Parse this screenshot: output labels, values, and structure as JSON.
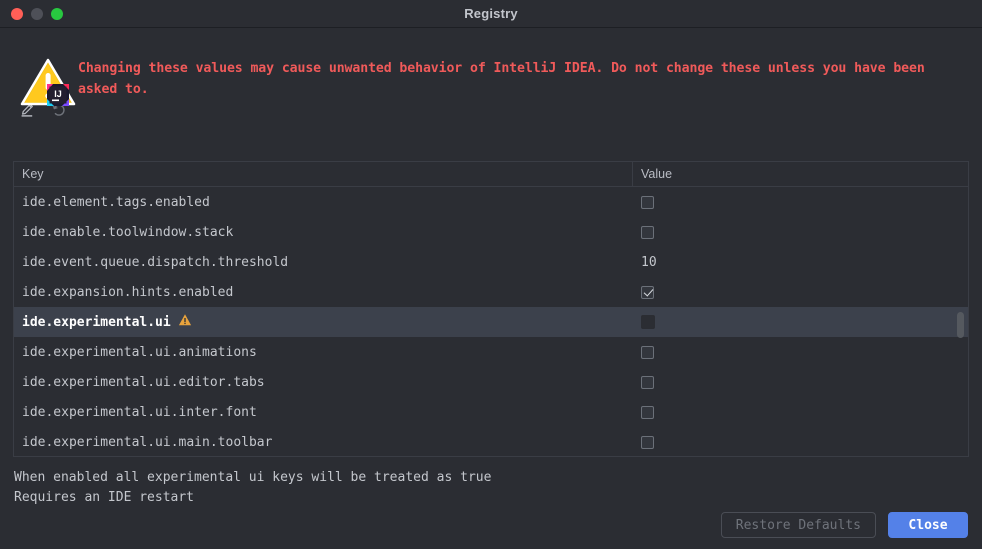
{
  "window": {
    "title": "Registry",
    "traffic_lights": [
      "close-button",
      "minimize-button",
      "maximize-button"
    ]
  },
  "banner": {
    "icon": "warning-triangle-intellij-icon",
    "text": "Changing these values may cause unwanted behavior of IntelliJ IDEA. Do not change these unless you have been asked to."
  },
  "toolbar": {
    "items": [
      {
        "name": "edit-icon",
        "tooltip": "Edit"
      },
      {
        "name": "revert-icon",
        "tooltip": "Revert"
      }
    ]
  },
  "table": {
    "columns": {
      "key": "Key",
      "value": "Value"
    },
    "rows": [
      {
        "key": "ide.element.tags.enabled",
        "value_type": "checkbox",
        "value": "unchecked",
        "selected": false,
        "warning": false
      },
      {
        "key": "ide.enable.toolwindow.stack",
        "value_type": "checkbox",
        "value": "unchecked",
        "selected": false,
        "warning": false
      },
      {
        "key": "ide.event.queue.dispatch.threshold",
        "value_type": "text",
        "value": "10",
        "selected": false,
        "warning": false
      },
      {
        "key": "ide.expansion.hints.enabled",
        "value_type": "checkbox",
        "value": "checked",
        "selected": false,
        "warning": false
      },
      {
        "key": "ide.experimental.ui",
        "value_type": "checkbox",
        "value": "editing",
        "selected": true,
        "warning": true
      },
      {
        "key": "ide.experimental.ui.animations",
        "value_type": "checkbox",
        "value": "unchecked",
        "selected": false,
        "warning": false
      },
      {
        "key": "ide.experimental.ui.editor.tabs",
        "value_type": "checkbox",
        "value": "unchecked",
        "selected": false,
        "warning": false
      },
      {
        "key": "ide.experimental.ui.inter.font",
        "value_type": "checkbox",
        "value": "unchecked",
        "selected": false,
        "warning": false
      },
      {
        "key": "ide.experimental.ui.main.toolbar",
        "value_type": "checkbox",
        "value": "unchecked",
        "selected": false,
        "warning": false
      }
    ]
  },
  "description": {
    "line1": "When enabled all experimental ui keys will be treated as true",
    "line2": "Requires an IDE restart"
  },
  "footer": {
    "restore_defaults_label": "Restore Defaults",
    "close_label": "Close"
  },
  "colors": {
    "window_bg": "#2b2d33",
    "warning_text": "#f05a5a",
    "accent_blue": "#5481e8",
    "selected_row": "#3c414c",
    "warning_amber": "#e8a33d"
  }
}
